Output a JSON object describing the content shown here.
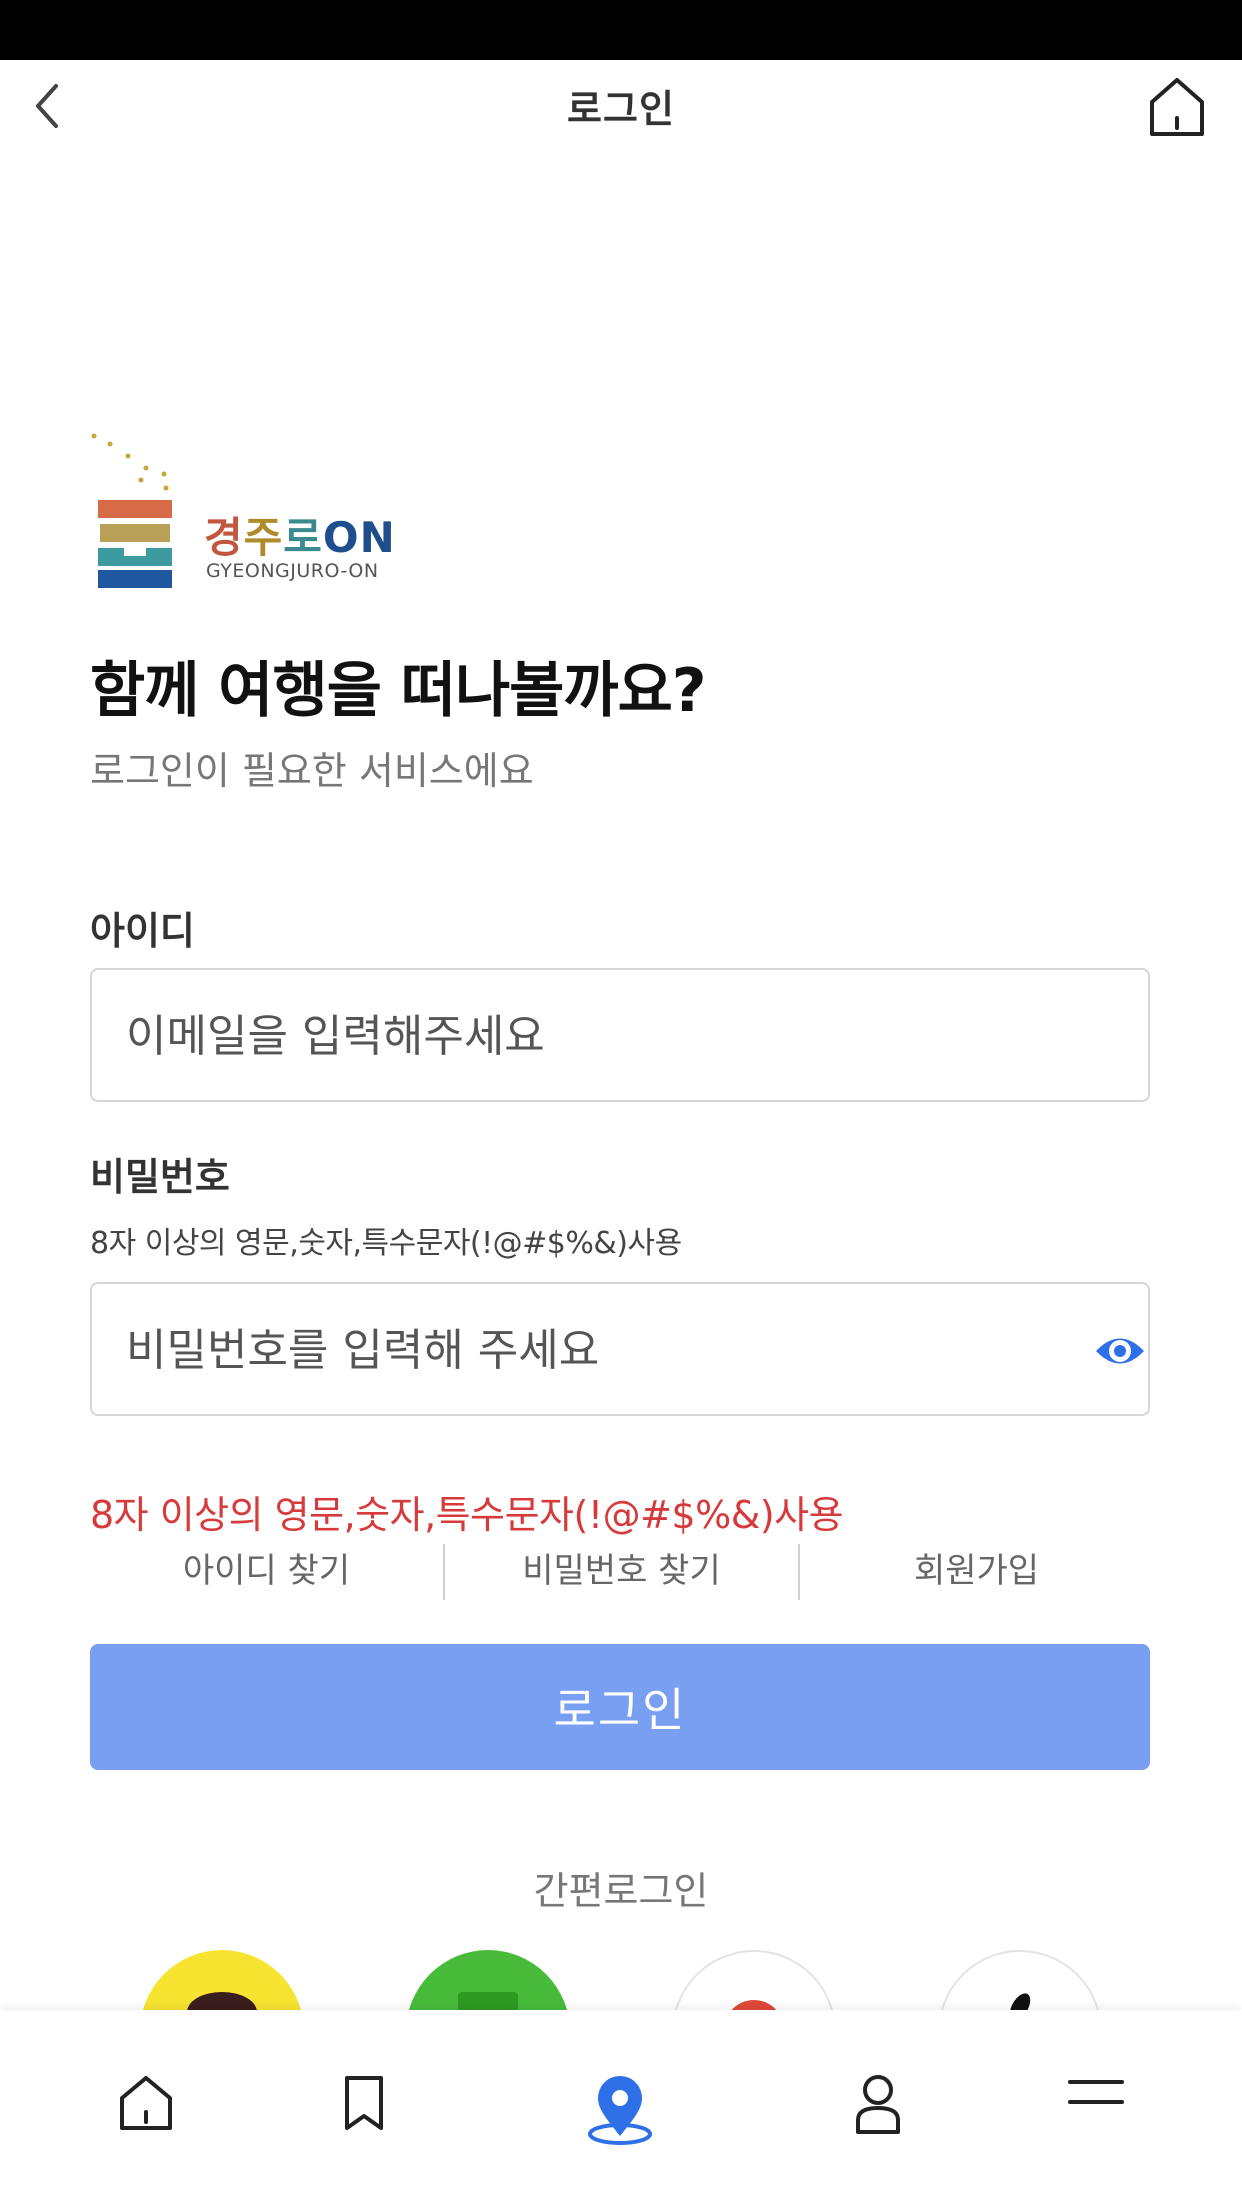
{
  "header": {
    "title": "로그인"
  },
  "logo": {
    "name_ko_1": "경",
    "name_ko_2": "주",
    "name_ko_3": "로",
    "name_ko_4": "ON",
    "name_en": "GYEONGJURO-ON"
  },
  "intro": {
    "headline": "함께 여행을 떠나볼까요?",
    "subline": "로그인이 필요한 서비스에요"
  },
  "form": {
    "id_label": "아이디",
    "id_placeholder": "이메일을 입력해주세요",
    "pw_label": "비밀번호",
    "pw_hint": "8자 이상의 영문,숫자,특수문자(!@#$%&)사용",
    "pw_placeholder": "비밀번호를 입력해 주세요",
    "error": "8자 이상의 영문,숫자,특수문자(!@#$%&)사용"
  },
  "links": {
    "find_id": "아이디 찾기",
    "find_pw": "비밀번호 찾기",
    "signup": "회원가입"
  },
  "login_button": "로그인",
  "easy_login": {
    "label": "간편로그인",
    "providers": [
      "kakao",
      "naver",
      "google",
      "apple"
    ]
  },
  "tabbar": {
    "items": [
      "home-icon",
      "bookmark-icon",
      "map-pin-icon",
      "user-icon",
      "menu-icon"
    ],
    "active": "map-pin-icon"
  },
  "colors": {
    "accent": "#789ff2",
    "error": "#d63a3a",
    "eye_icon": "#2f6fe8",
    "active_tab": "#2f6fe8"
  }
}
